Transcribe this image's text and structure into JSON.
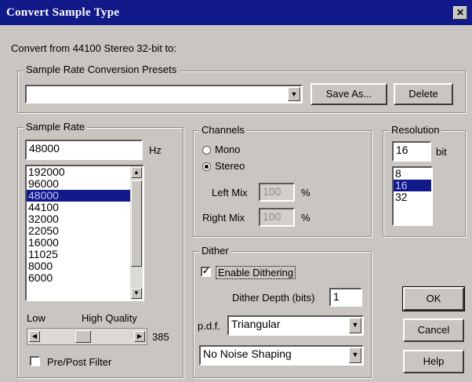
{
  "window": {
    "title": "Convert Sample Type",
    "close_glyph": "✕"
  },
  "header": {
    "convert_from": "Convert from 44100 Stereo 32-bit to:"
  },
  "presets": {
    "group_label": "Sample Rate Conversion Presets",
    "selected": "",
    "save_as_label": "Save As...",
    "delete_label": "Delete"
  },
  "sample_rate": {
    "group_label": "Sample Rate",
    "value": "48000",
    "unit": "Hz",
    "items": [
      "192000",
      "96000",
      "48000",
      "44100",
      "32000",
      "22050",
      "16000",
      "11025",
      "8000",
      "6000"
    ],
    "selected_index": 2,
    "quality_low_label": "Low",
    "quality_high_label": "High Quality",
    "quality_value": "385",
    "quality_fraction": 0.45,
    "prepost_label": "Pre/Post Filter",
    "prepost_checked": false
  },
  "channels": {
    "group_label": "Channels",
    "mono_label": "Mono",
    "stereo_label": "Stereo",
    "selected": "stereo",
    "left_mix_label": "Left Mix",
    "left_mix_value": "100",
    "right_mix_label": "Right Mix",
    "right_mix_value": "100",
    "percent": "%"
  },
  "resolution": {
    "group_label": "Resolution",
    "value": "16",
    "unit": "bit",
    "items": [
      "8",
      "16",
      "32"
    ],
    "selected_index": 1
  },
  "dither": {
    "group_label": "Dither",
    "enable_label": "Enable Dithering",
    "enable_checked": true,
    "depth_label": "Dither Depth (bits)",
    "depth_value": "1",
    "pdf_label": "p.d.f.",
    "pdf_value": "Triangular",
    "shaping_value": "No Noise Shaping"
  },
  "buttons": {
    "ok": "OK",
    "cancel": "Cancel",
    "help": "Help"
  },
  "icons": {
    "arrow_down": "▼",
    "arrow_up": "▲",
    "arrow_left": "◀",
    "arrow_right": "▶",
    "check": "✓"
  }
}
